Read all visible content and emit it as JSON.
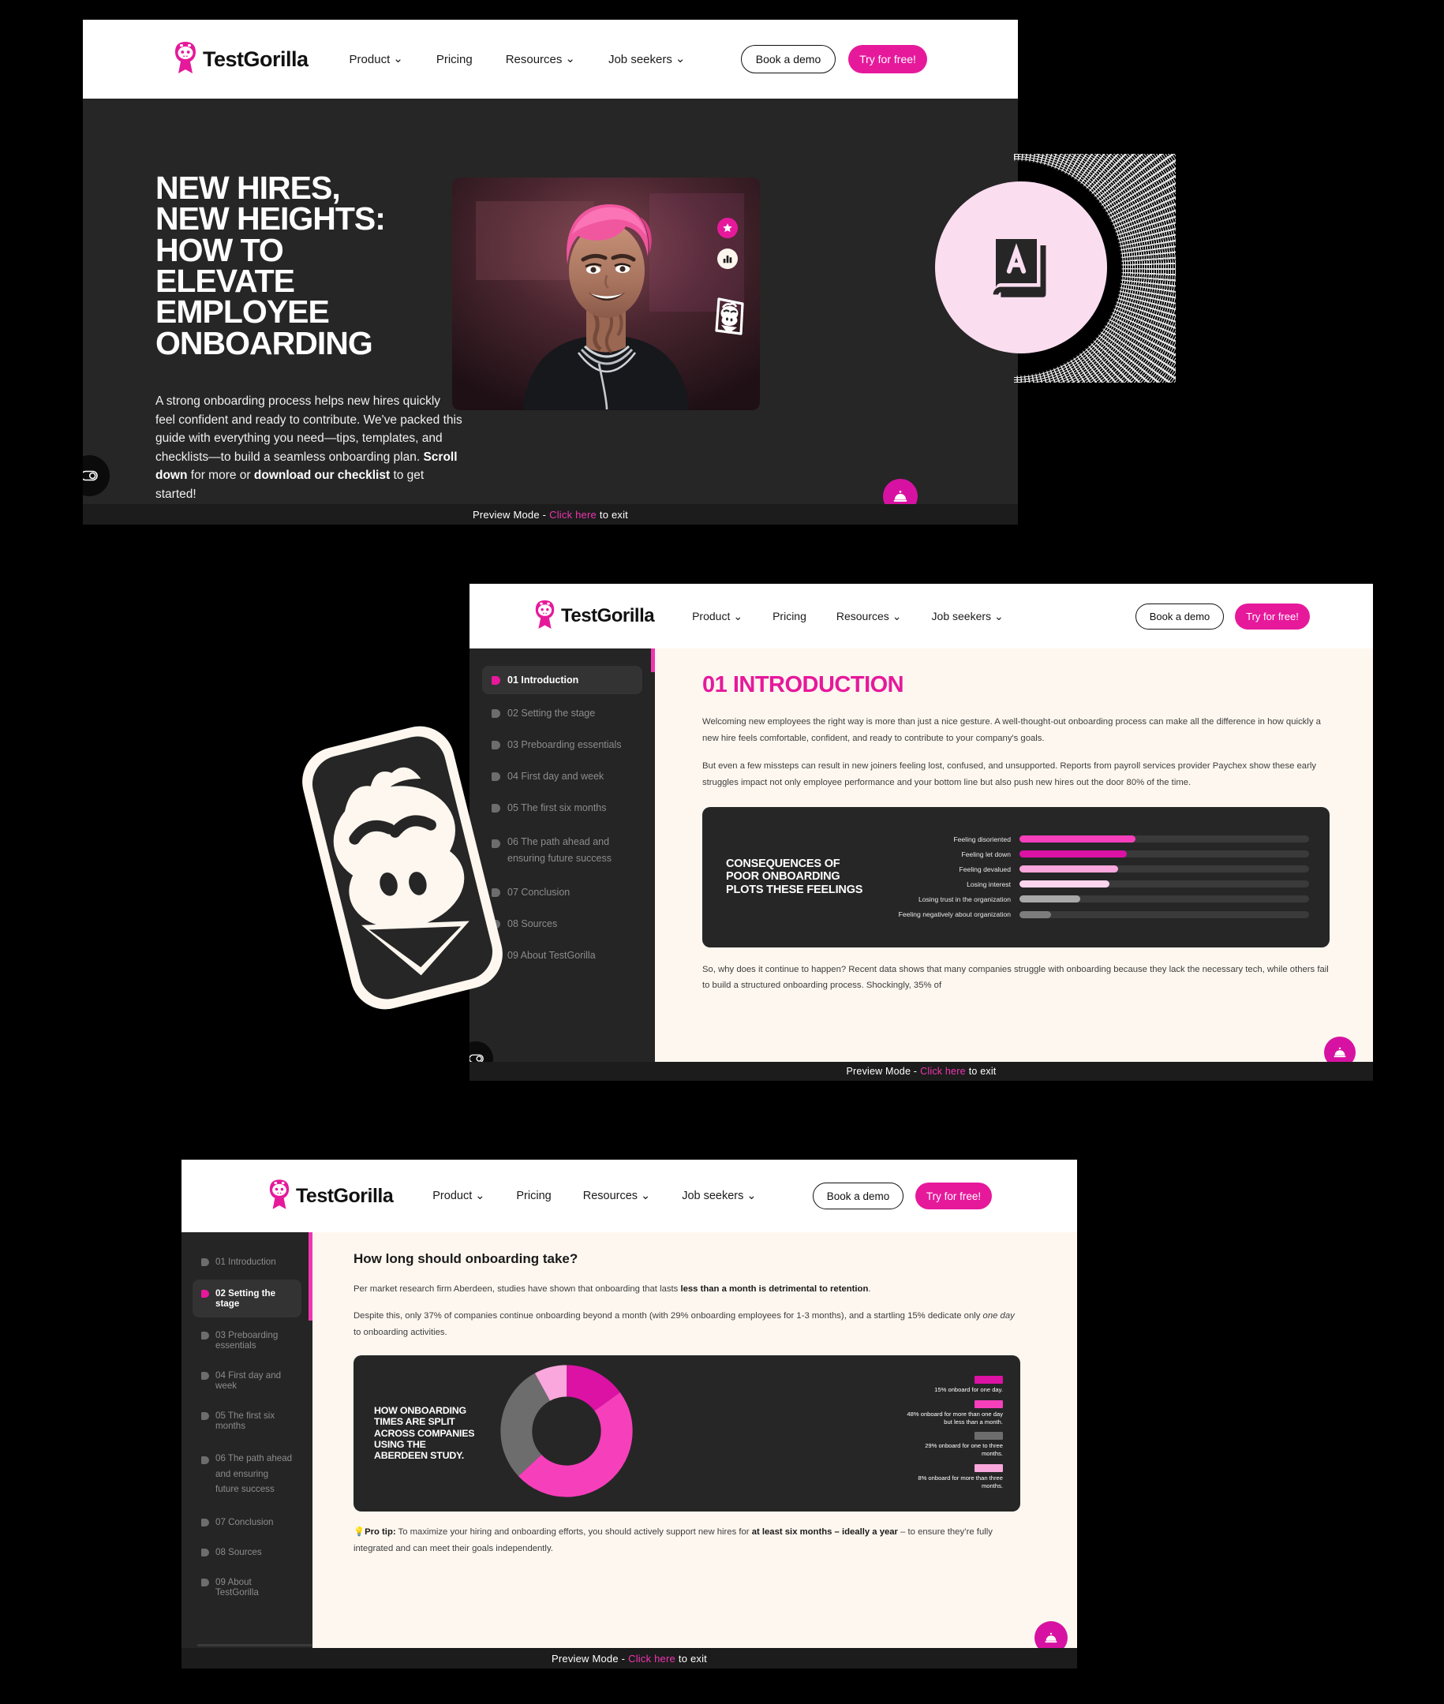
{
  "brand": {
    "name": "TestGorilla",
    "logo_icon": "gorilla-logo-icon"
  },
  "nav": {
    "links": [
      {
        "label": "Product",
        "caret": "⌄"
      },
      {
        "label": "Pricing",
        "caret": ""
      },
      {
        "label": "Resources",
        "caret": "⌄"
      },
      {
        "label": "Job seekers",
        "caret": "⌄"
      }
    ],
    "demo_label": "Book a demo",
    "try_label": "Try for free!"
  },
  "preview_bar": {
    "prefix": "Preview Mode - ",
    "link": "Click here",
    "suffix": " to exit"
  },
  "window1": {
    "hero": {
      "heading": "NEW HIRES, NEW HEIGHTS: HOW TO ELEVATE EMPLOYEE ONBOARDING",
      "heading_lines": [
        "NEW HIRES,",
        "NEW HEIGHTS:",
        "HOW TO",
        "ELEVATE",
        "EMPLOYEE",
        "ONBOARDING"
      ],
      "paragraph_part1": "A strong onboarding process helps new hires quickly feel confident and ready to contribute. We've packed this guide with everything you need—tips, templates, and checklists—to build a seamless onboarding plan. ",
      "paragraph_bold1": "Scroll down",
      "paragraph_part2": " for more or ",
      "paragraph_bold2": "download our checklist",
      "paragraph_part3": " to get started!",
      "badges": [
        "star-badge-icon",
        "bar-chart-badge-icon",
        "gorilla-badge-icon"
      ],
      "book_badge_icon": "book-a-icon",
      "fab_icon": "service-bell-icon",
      "cookie_icon": "cookie-consent-icon"
    }
  },
  "guide_nav": {
    "items": [
      {
        "label": "01 Introduction"
      },
      {
        "label": "02 Setting the stage"
      },
      {
        "label": "03 Preboarding essentials"
      },
      {
        "label": "04 First day and week"
      },
      {
        "label": "05 The first six months"
      },
      {
        "label": "06 The path ahead and ensuring future success"
      },
      {
        "label": "07 Conclusion"
      },
      {
        "label": "08 Sources"
      },
      {
        "label": "09 About TestGorilla"
      }
    ]
  },
  "window2": {
    "active_index": 0,
    "title": "01 INTRODUCTION",
    "paragraphs": [
      "Welcoming new employees the right way is more than just a nice gesture. A well-thought-out onboarding process can make all the difference in how quickly a new hire feels comfortable, confident, and ready to contribute to your company's goals.",
      "But even a few missteps can result in new joiners feeling lost, confused, and unsupported. Reports from payroll services provider Paychex show these early struggles impact not only employee performance and your bottom line but also push new hires out the door 80% of the time."
    ],
    "paragraph_after": "So, why does it continue to happen? Recent data shows that many companies struggle with onboarding because they lack the necessary tech, while others fail to build a structured onboarding process. Shockingly, 35% of",
    "chart_data": {
      "type": "bar",
      "title": "CONSEQUENCES OF POOR ONBOARDING PLOTS THESE FEELINGS",
      "orientation": "horizontal",
      "xlabel": "",
      "ylabel": "",
      "grid": false,
      "legend": "none",
      "categories": [
        "Feeling disoriented",
        "Feeling let down",
        "Feeling devalued",
        "Losing interest",
        "Losing trust in the organization",
        "Feeling negatively about organization"
      ],
      "values": [
        40,
        37,
        34,
        31,
        21,
        11
      ],
      "xlim": [
        0,
        100
      ],
      "colors": [
        "#f63fbb",
        "#db12a4",
        "#f9a7dc",
        "#fbd4ee",
        "#a8a8a8",
        "#7d7d7d"
      ],
      "track_color": "#3a3a3a"
    }
  },
  "window3": {
    "active_index": 1,
    "heading": "How long should onboarding take?",
    "paragraph1_part1": "Per market research firm Aberdeen, studies have shown that onboarding that lasts ",
    "paragraph1_bold": "less than a month is detrimental to retention",
    "paragraph1_part2": ".",
    "paragraph2_part1": "Despite this, only 37% of companies continue onboarding beyond a month (with 29% onboarding employees for 1-3 months), and a startling 15% dedicate only ",
    "paragraph2_italic": "one day",
    "paragraph2_part2": " to onboarding activities.",
    "protip_icon": "lightbulb-icon",
    "protip_label": "Pro tip:",
    "protip_part1": " To maximize your hiring and onboarding efforts, you should actively support new hires for ",
    "protip_bold": "at least six months – ideally a year",
    "protip_part2": " – to ensure they’re fully integrated and can meet their goals independently.",
    "chart_data": {
      "type": "pie",
      "variant": "donut",
      "title": "HOW ONBOARDING TIMES ARE SPLIT ACROSS COMPANIES USING THE ABERDEEN STUDY.",
      "labels": [
        "15% onboard for one day.",
        "48% onboard for more than one day but less than a month.",
        "29% onboard for one to three months.",
        "8% onboard for more than three months."
      ],
      "values": [
        15,
        48,
        29,
        8
      ],
      "colors": [
        "#db12a4",
        "#f63fbb",
        "#6d6d6d",
        "#f9a7dc"
      ],
      "legend": "right",
      "hole": 0.58
    }
  }
}
